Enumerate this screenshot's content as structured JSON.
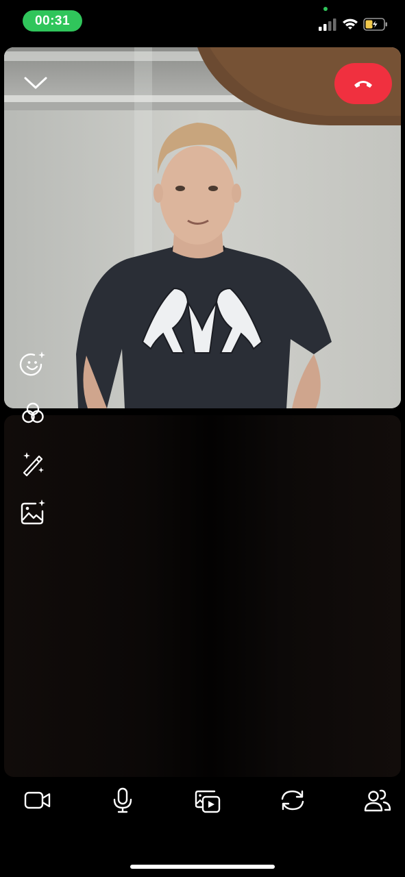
{
  "status_bar": {
    "time": "00:31",
    "colors": {
      "time_pill": "#30c55b",
      "battery_fill": "#f2c94c"
    }
  },
  "call": {
    "colors": {
      "end_call": "#f0303f"
    },
    "icons": {
      "collapse": "chevron-down-icon",
      "end_call": "phone-hangup-icon"
    }
  },
  "side_tools": [
    {
      "name": "face-effects-icon"
    },
    {
      "name": "color-filter-icon"
    },
    {
      "name": "magic-wand-icon"
    },
    {
      "name": "background-image-icon"
    }
  ],
  "bottom_bar": [
    {
      "name": "camera-toggle-icon"
    },
    {
      "name": "microphone-icon"
    },
    {
      "name": "screen-share-icon"
    },
    {
      "name": "flip-camera-icon"
    },
    {
      "name": "participants-icon"
    }
  ]
}
